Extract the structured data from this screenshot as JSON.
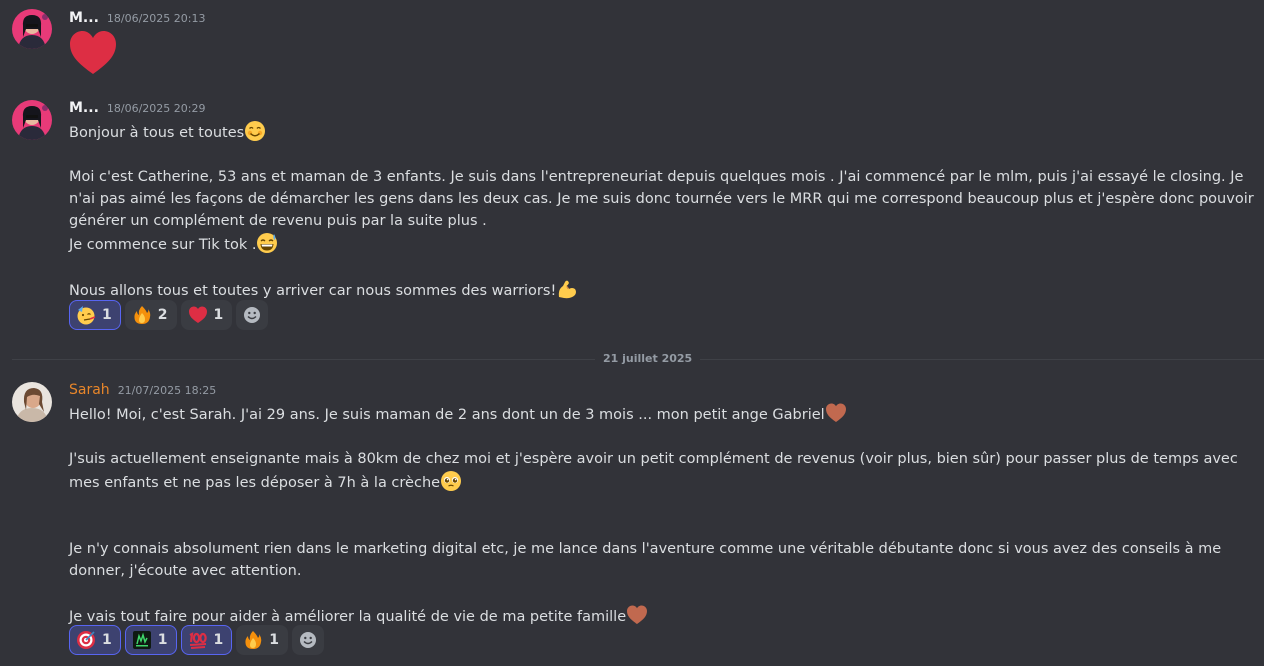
{
  "messages": [
    {
      "author": "M...",
      "timestamp": "18/06/2025 20:13",
      "content": "❤"
    },
    {
      "author": "M...",
      "timestamp": "18/06/2025 20:29",
      "lines": [
        "Bonjour à tous et toutes",
        "",
        "Moi c'est Catherine, 53 ans et maman de 3 enfants. Je suis dans l'entrepreneuriat depuis quelques mois . J'ai commencé par le mlm, puis j'ai essayé le closing. Je n'ai pas aimé les façons de démarcher les gens dans les deux cas. Je me suis donc tournée vers le MRR qui me correspond beaucoup plus et j'espère donc pouvoir générer un complément de revenu puis par la suite plus .",
        "Je commence sur Tik tok .",
        "",
        "Nous allons tous et toutes y arriver car nous sommes des warriors!"
      ],
      "reactions": [
        {
          "emoji": "partying-face",
          "count": "1"
        },
        {
          "emoji": "fire",
          "count": "2"
        },
        {
          "emoji": "red-heart",
          "count": "1"
        }
      ]
    },
    {
      "author": "Sarah",
      "timestamp": "21/07/2025 18:25",
      "lines": [
        "Hello! Moi, c'est Sarah. J'ai 29 ans. Je suis maman de 2 ans dont un de 3 mois ... mon petit ange Gabriel",
        "",
        "J'suis actuellement enseignante mais à 80km de chez moi et j'espère avoir un petit complément de revenus (voir plus, bien sûr)  pour passer plus de temps avec mes enfants et ne pas les déposer à 7h à la crèche",
        "",
        "",
        "Je n'y connais absolument rien dans le marketing digital etc, je me lance dans l'aventure comme une véritable débutante donc si vous avez des conseils à me donner, j'écoute avec attention.",
        "",
        "Je vais tout faire pour aider à améliorer la qualité de vie de ma petite famille"
      ],
      "reactions": [
        {
          "emoji": "direct-hit",
          "count": "1"
        },
        {
          "emoji": "custom-sticker",
          "count": "1"
        },
        {
          "emoji": "hundred-points",
          "count": "1"
        },
        {
          "emoji": "fire",
          "count": "1"
        }
      ]
    }
  ],
  "date_divider": "21 juillet 2025",
  "colors": {
    "background": "#323339",
    "sarah_name": "#e8862a",
    "reaction_selected": "#5865f2"
  }
}
